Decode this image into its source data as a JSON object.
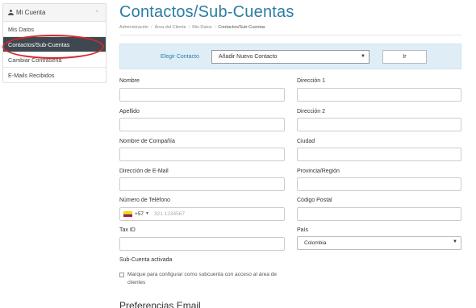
{
  "sidebar": {
    "header": "Mi Cuenta",
    "items": [
      {
        "label": "Mis Datos"
      },
      {
        "label": "Contactos/Sub-Cuentas"
      },
      {
        "label": "Cambiar Contraseña"
      },
      {
        "label": "E-Mails Recibidos"
      }
    ],
    "active_index": 1
  },
  "header": {
    "title": "Contactos/Sub-Cuentas",
    "breadcrumb": [
      "Administración",
      "Área del Cliente",
      "Mis Datos",
      "Contactos/Sub-Cuentas"
    ]
  },
  "chooser": {
    "label": "Elegir Contacto",
    "selected": "Añadir Nuevo Contacto",
    "go_label": "Ir"
  },
  "form": {
    "nombre": "Nombre",
    "apellido": "Apellido",
    "compania": "Nombre de Compañía",
    "email": "Dirección de E-Mail",
    "telefono": "Número de Teléfono",
    "phone_code": "+57",
    "phone_placeholder": "321 1234567",
    "tax_id": "Tax ID",
    "direccion1": "Dirección 1",
    "direccion2": "Dirección 2",
    "ciudad": "Ciudad",
    "provincia": "Provincia/Región",
    "postal": "Código Postal",
    "pais": "País",
    "pais_value": "Colombia",
    "subcuenta_label": "Sub-Cuenta activada",
    "subcuenta_checkbox": "Marque para configurar como subcuenta con acceso al área de clientes",
    "preferencias": "Preferencias Email"
  },
  "colors": {
    "accent": "#2b7da3",
    "active_bg": "#3f4850",
    "highlight_ring": "#d9262b",
    "chooser_bg": "#dfeef6"
  }
}
